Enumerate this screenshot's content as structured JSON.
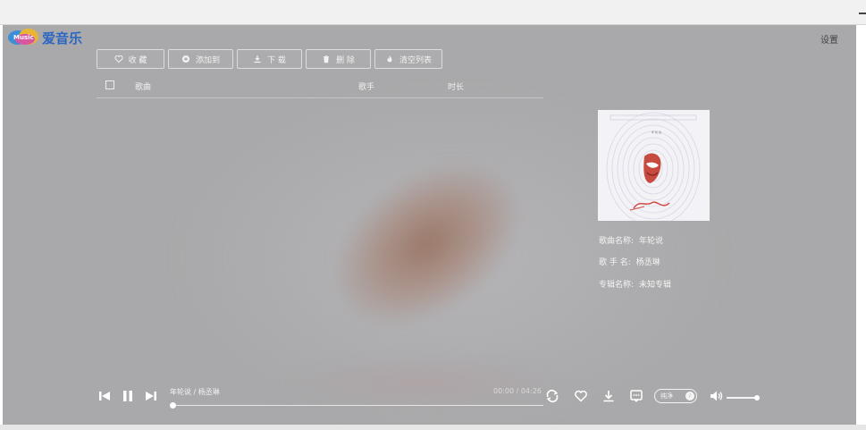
{
  "brand": {
    "logo_text": "爱音乐",
    "logo_mark_text": "Music"
  },
  "header": {
    "settings_label": "设置"
  },
  "toolbar": {
    "buttons": [
      {
        "label": "收 藏",
        "icon": "heart-icon"
      },
      {
        "label": "添加到",
        "icon": "plus-circle-icon"
      },
      {
        "label": "下 载",
        "icon": "download-icon"
      },
      {
        "label": "删 除",
        "icon": "trash-icon"
      },
      {
        "label": "清空列表",
        "icon": "flame-icon"
      }
    ]
  },
  "list": {
    "columns": {
      "song": "歌曲",
      "artist": "歌手",
      "duration": "时长"
    },
    "rows": []
  },
  "song_info": {
    "name_label": "歌曲名称:",
    "name_value": "年轮说",
    "artist_label": "歌 手 名:",
    "artist_value": "杨丞琳",
    "album_label": "专辑名称:",
    "album_value": "未知专辑"
  },
  "player": {
    "now_playing": "年轮说 / 杨丞琳",
    "time": "00:00 / 04:26",
    "progress": 0,
    "quality_label": "纯净",
    "volume": 0.95
  },
  "colors": {
    "accent_logo": "#2b67c2",
    "panel_bg": "#a9a9ab"
  }
}
